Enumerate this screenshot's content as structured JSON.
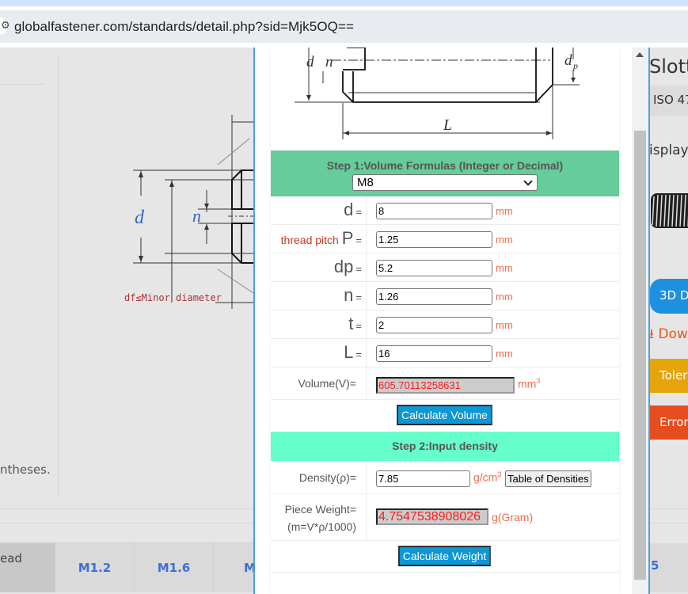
{
  "browser": {
    "url": "globalfastener.com/standards/detail.php?sid=Mjk5OQ=="
  },
  "background_page": {
    "parentheses_text": "ntheses.",
    "thread_header": "ead",
    "sizes": [
      "M1.2",
      "M1.6",
      "M"
    ],
    "right_size": "5",
    "drawing": {
      "d_label": "d",
      "n_label": "n",
      "minor_diameter_note": "df≤Minor diameter"
    },
    "right_panel": {
      "title": "Slott",
      "standard": "ISO 47",
      "display": "isplay",
      "btn_3d": "3D D",
      "download": "⭳ Dow",
      "tolerance": "Toler",
      "error": "Error"
    }
  },
  "calculator": {
    "diagram": {
      "d_label": "d",
      "n_label": "n",
      "dp_label": "d",
      "dp_sub": "p",
      "L_label": "L"
    },
    "step1": {
      "title": "Step 1:Volume Formulas (Integer or Decimal)",
      "selected_size": "M8"
    },
    "fields": [
      {
        "prefix": "",
        "name": "d",
        "eq": "=",
        "value": "8",
        "unit": "mm"
      },
      {
        "prefix": "thread pitch ",
        "name": "P",
        "eq": "=",
        "value": "1.25",
        "unit": "mm"
      },
      {
        "prefix": "",
        "name": "dp",
        "eq": "=",
        "value": "5.2",
        "unit": "mm"
      },
      {
        "prefix": "",
        "name": "n",
        "eq": "=",
        "value": "1.26",
        "unit": "mm"
      },
      {
        "prefix": "",
        "name": "t",
        "eq": "=",
        "value": "2",
        "unit": "mm"
      },
      {
        "prefix": "",
        "name": "L",
        "eq": "=",
        "value": "16",
        "unit": "mm"
      }
    ],
    "volume": {
      "label": "Volume(V)=",
      "value": "605.70113258631",
      "unit": "mm",
      "unit_sup": "3"
    },
    "calculate_volume_label": "Calculate Volume",
    "step2": {
      "title": "Step 2:Input density"
    },
    "density": {
      "label": "Density(ρ)=",
      "value": "7.85",
      "unit": "g/cm",
      "unit_sup": "3",
      "table_button": "Table of Densities"
    },
    "weight": {
      "label_line1": "Piece Weight=",
      "label_line2": "(m=V*ρ/1000)",
      "value": "4.7547538908026",
      "unit": "g(Gram)"
    },
    "calculate_weight_label": "Calculate Weight"
  },
  "colors": {
    "step1_header": "#66cc99",
    "step2_header": "#66ffcc",
    "action_button": "#0d97d4",
    "result_text": "#ff1a1a",
    "unit_text": "#f06a4a",
    "popup_border": "#4aa3d8"
  }
}
